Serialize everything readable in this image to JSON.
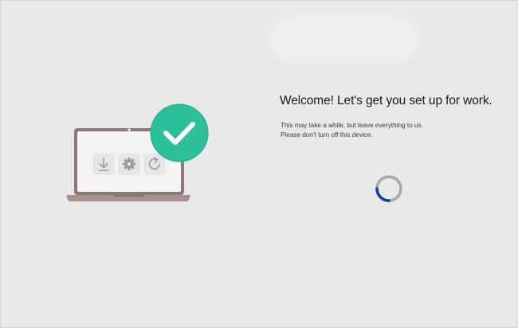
{
  "screen": {
    "title": "Welcome! Let's get you set up for work.",
    "description_line1": "This may take a while, but leave everything to us.",
    "description_line2": "Please don't turn off this device."
  },
  "illustration": {
    "icons": [
      "download-icon",
      "gear-icon",
      "refresh-icon"
    ],
    "badge_icon": "checkmark-icon",
    "badge_color": "#2bbf9a"
  },
  "progress": {
    "state": "loading",
    "spinner_color": "#0a3fa8"
  }
}
